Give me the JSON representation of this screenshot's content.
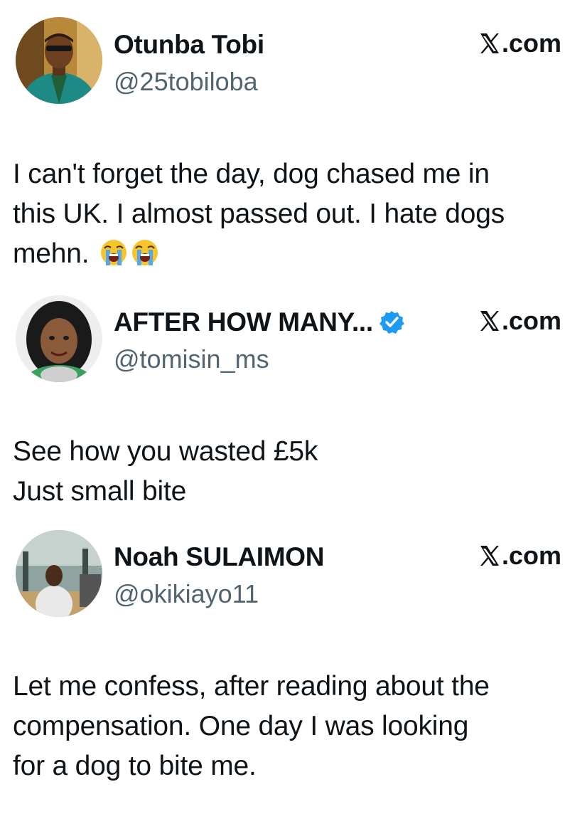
{
  "posts": [
    {
      "display_name": "Otunba Tobi",
      "handle": "@25tobiloba",
      "verified": false,
      "source": ".com",
      "avatar_icon": "user-avatar-photo",
      "lines": [
        "I can't forget the day, dog chased me in",
        "this UK. I almost passed out. I hate dogs",
        "mehn."
      ],
      "emoji": [
        "loudly-crying-face-icon",
        "loudly-crying-face-icon"
      ]
    },
    {
      "display_name": "AFTER HOW MANY...",
      "handle": "@tomisin_ms",
      "verified": true,
      "source": ".com",
      "avatar_icon": "user-avatar-photo",
      "lines": [
        "See how you wasted £5k",
        "Just small bite"
      ]
    },
    {
      "display_name": "Noah SULAIMON",
      "handle": "@okikiayo11",
      "verified": false,
      "source": ".com",
      "avatar_icon": "user-avatar-photo",
      "lines": [
        "Let me confess, after reading about the",
        "compensation. One day I was looking",
        "for a dog to bite me."
      ]
    }
  ],
  "colors": {
    "text": "#0f1419",
    "handle": "#536471",
    "verified": "#1d9bf0",
    "background": "#ffffff"
  }
}
